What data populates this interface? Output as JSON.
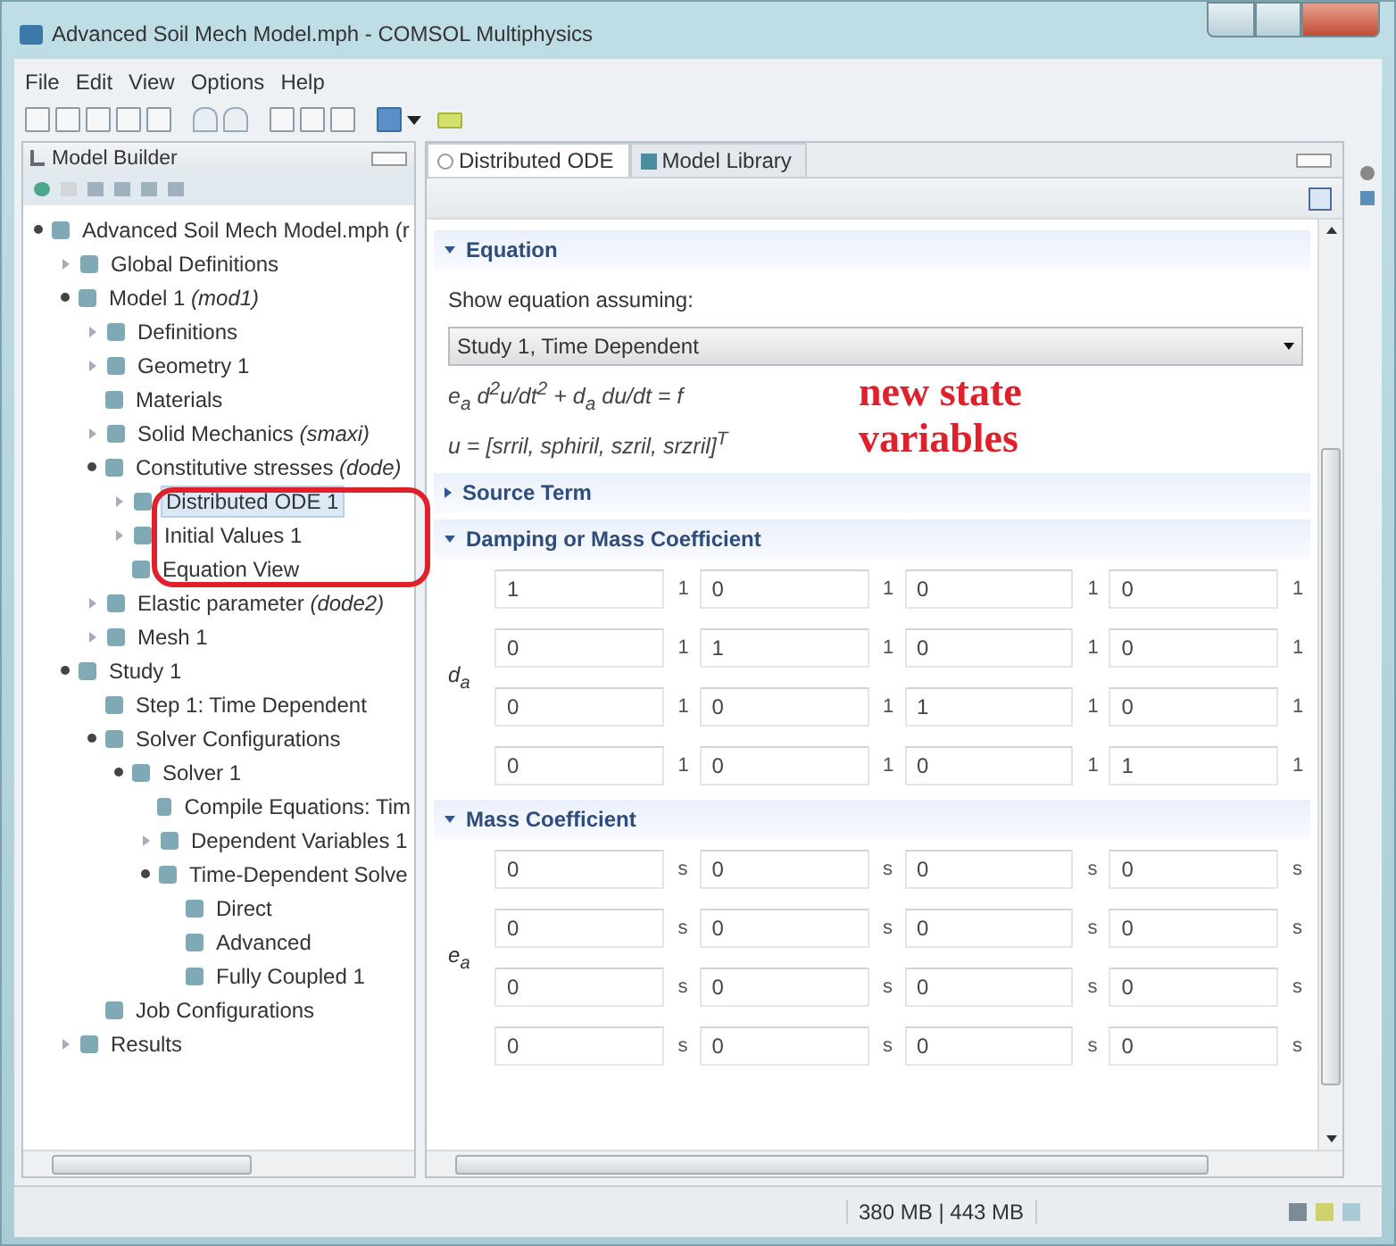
{
  "window": {
    "title": "Advanced Soil Mech Model.mph - COMSOL Multiphysics"
  },
  "menu": [
    "File",
    "Edit",
    "View",
    "Options",
    "Help"
  ],
  "model_builder": {
    "title": "Model Builder",
    "tree": [
      {
        "label": "Advanced Soil Mech Model.mph (r",
        "expanded": true,
        "selected": false,
        "children": [
          {
            "label": "Global Definitions",
            "expanded": false,
            "selected": false
          },
          {
            "label": "Model 1 *(mod1)*",
            "expanded": true,
            "selected": false,
            "children": [
              {
                "label": "Definitions",
                "expanded": false,
                "selected": false
              },
              {
                "label": "Geometry 1",
                "expanded": false,
                "selected": false
              },
              {
                "label": "Materials",
                "selected": false
              },
              {
                "label": "Solid Mechanics *(smaxi)*",
                "expanded": false,
                "selected": false
              },
              {
                "label": "Constitutive stresses *(dode)*",
                "expanded": true,
                "selected": false,
                "children": [
                  {
                    "label": "Distributed ODE 1",
                    "expanded": false,
                    "selected": true
                  },
                  {
                    "label": "Initial Values 1",
                    "expanded": false,
                    "selected": false
                  },
                  {
                    "label": "Equation View",
                    "selected": false
                  }
                ]
              },
              {
                "label": "Elastic parameter *(dode2)*",
                "expanded": false,
                "selected": false
              },
              {
                "label": "Mesh 1",
                "expanded": false,
                "selected": false
              }
            ]
          },
          {
            "label": "Study 1",
            "expanded": true,
            "selected": false,
            "children": [
              {
                "label": "Step 1: Time Dependent",
                "selected": false
              },
              {
                "label": "Solver Configurations",
                "expanded": true,
                "selected": false,
                "children": [
                  {
                    "label": "Solver 1",
                    "expanded": true,
                    "selected": false,
                    "children": [
                      {
                        "label": "Compile Equations: Tim",
                        "selected": false
                      },
                      {
                        "label": "Dependent Variables 1",
                        "expanded": false,
                        "selected": false
                      },
                      {
                        "label": "Time-Dependent Solve",
                        "expanded": true,
                        "selected": false,
                        "children": [
                          {
                            "label": "Direct",
                            "selected": false
                          },
                          {
                            "label": "Advanced",
                            "selected": false
                          },
                          {
                            "label": "Fully Coupled 1",
                            "selected": false
                          }
                        ]
                      }
                    ]
                  }
                ]
              },
              {
                "label": "Job Configurations",
                "selected": false
              }
            ]
          },
          {
            "label": "Results",
            "expanded": false,
            "selected": false
          }
        ]
      }
    ]
  },
  "tabs": [
    {
      "label": "Distributed ODE",
      "selected": true
    },
    {
      "label": "Model Library",
      "selected": false
    }
  ],
  "sections": [
    {
      "title": "Equation",
      "expanded": true,
      "kind": "equation",
      "prompt": "Show equation assuming:",
      "select": "Study 1, Time Dependent",
      "lines": [
        "e$_{a}$ d$^{2}$u/dt$^{2}$ + d$_{a}$ du/dt = f",
        "u = [srril, sphiril, szril, srzril]$^{T}$"
      ]
    },
    {
      "title": "Source Term",
      "expanded": false
    },
    {
      "title": "Damping or Mass Coefficient",
      "expanded": true,
      "kind": "matrix",
      "symbol": "d$_{a}$",
      "rows": [
        [
          {
            "value": "1",
            "unit": "1"
          },
          {
            "value": "0",
            "unit": "1"
          },
          {
            "value": "0",
            "unit": "1"
          },
          {
            "value": "0",
            "unit": "1"
          }
        ],
        [
          {
            "value": "0",
            "unit": "1"
          },
          {
            "value": "1",
            "unit": "1"
          },
          {
            "value": "0",
            "unit": "1"
          },
          {
            "value": "0",
            "unit": "1"
          }
        ],
        [
          {
            "value": "0",
            "unit": "1"
          },
          {
            "value": "0",
            "unit": "1"
          },
          {
            "value": "1",
            "unit": "1"
          },
          {
            "value": "0",
            "unit": "1"
          }
        ],
        [
          {
            "value": "0",
            "unit": "1"
          },
          {
            "value": "0",
            "unit": "1"
          },
          {
            "value": "0",
            "unit": "1"
          },
          {
            "value": "1",
            "unit": "1"
          }
        ]
      ]
    },
    {
      "title": "Mass Coefficient",
      "expanded": true,
      "kind": "matrix",
      "symbol": "e$_{a}$",
      "rows": [
        [
          {
            "value": "0",
            "unit": "s"
          },
          {
            "value": "0",
            "unit": "s"
          },
          {
            "value": "0",
            "unit": "s"
          },
          {
            "value": "0",
            "unit": "s"
          }
        ],
        [
          {
            "value": "0",
            "unit": "s"
          },
          {
            "value": "0",
            "unit": "s"
          },
          {
            "value": "0",
            "unit": "s"
          },
          {
            "value": "0",
            "unit": "s"
          }
        ],
        [
          {
            "value": "0",
            "unit": "s"
          },
          {
            "value": "0",
            "unit": "s"
          },
          {
            "value": "0",
            "unit": "s"
          },
          {
            "value": "0",
            "unit": "s"
          }
        ],
        [
          {
            "value": "0",
            "unit": "s"
          },
          {
            "value": "0",
            "unit": "s"
          },
          {
            "value": "0",
            "unit": "s"
          },
          {
            "value": "0",
            "unit": "s"
          }
        ]
      ]
    }
  ],
  "status_bar": {
    "memory": "380 MB | 443 MB"
  },
  "annotation": {
    "text": "new state variables"
  }
}
